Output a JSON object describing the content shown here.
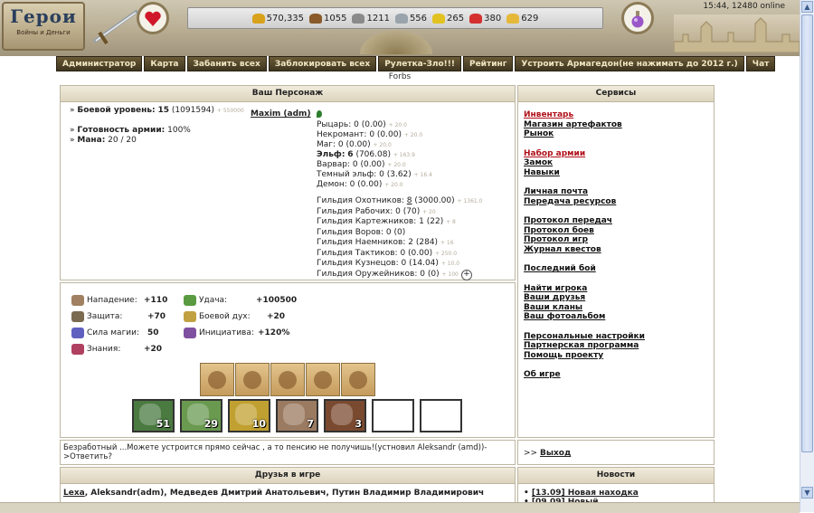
{
  "header": {
    "logo_title": "Герои",
    "logo_subtitle": "Войны и Деньги",
    "status_time": "15:44, 12480 online",
    "resources": [
      {
        "icon": "gold-icon",
        "value": "570,335"
      },
      {
        "icon": "wood-icon",
        "value": "1055"
      },
      {
        "icon": "ore-icon",
        "value": "1211"
      },
      {
        "icon": "mercury-icon",
        "value": "556"
      },
      {
        "icon": "sulfur-icon",
        "value": "265"
      },
      {
        "icon": "crystal-icon",
        "value": "380"
      },
      {
        "icon": "gems-icon",
        "value": "629"
      }
    ]
  },
  "menu": [
    "Администратор",
    "Карта",
    "Забанить всех",
    "Заблокировать всех",
    "Рулетка-Зло!!!",
    "Рейтинг",
    "Устроить Армагедон(не нажимать до 2012 г.)",
    "Чат"
  ],
  "forbs": "Forbs",
  "character": {
    "panel_title": "Ваш Персонаж",
    "name": "Maxim (adm)",
    "combat_level_label": "Боевой уровень:",
    "combat_level": "15",
    "combat_exp": "(1091594)",
    "combat_small": "+ 550000",
    "army_ready_label": "Готовность армии:",
    "army_ready": "100%",
    "mana_label": "Мана:",
    "mana": "20 / 20",
    "factions": [
      {
        "name": "Рыцарь:",
        "level": "0",
        "value": "(0.00)",
        "small": "+ 20.0",
        "bold": false
      },
      {
        "name": "Некромант:",
        "level": "0",
        "value": "(0.00)",
        "small": "+ 20.0",
        "bold": false
      },
      {
        "name": "Маг:",
        "level": "0",
        "value": "(0.00)",
        "small": "+ 20.0",
        "bold": false
      },
      {
        "name": "Эльф:",
        "level": "6",
        "value": "(706.08)",
        "small": "+ 163.9",
        "bold": true
      },
      {
        "name": "Варвар:",
        "level": "0",
        "value": "(0.00)",
        "small": "+ 20.0",
        "bold": false
      },
      {
        "name": "Темный эльф:",
        "level": "0",
        "value": "(3.62)",
        "small": "+ 16.4",
        "bold": false
      },
      {
        "name": "Демон:",
        "level": "0",
        "value": "(0.00)",
        "small": "+ 20.0",
        "bold": false
      }
    ],
    "guilds": [
      {
        "name": "Гильдия Охотников:",
        "level": "8",
        "value": "(3000.00)",
        "small": "+ 1361.0"
      },
      {
        "name": "Гильдия Рабочих:",
        "level": "0",
        "value": "(70)",
        "small": "+ 20"
      },
      {
        "name": "Гильдия Картежников:",
        "level": "1",
        "value": "(22)",
        "small": "+ 8"
      },
      {
        "name": "Гильдия Воров:",
        "level": "0",
        "value": "(0)",
        "small": ""
      },
      {
        "name": "Гильдия Наемников:",
        "level": "2",
        "value": "(284)",
        "small": "+ 16"
      },
      {
        "name": "Гильдия Тактиков:",
        "level": "0",
        "value": "(0.00)",
        "small": "+ 250.0"
      },
      {
        "name": "Гильдия Кузнецов:",
        "level": "0",
        "value": "(14.04)",
        "small": "+ 10.0"
      },
      {
        "name": "Гильдия Оружейников:",
        "level": "0",
        "value": "(0)",
        "small": "+ 100"
      }
    ],
    "plus_symbol": "+"
  },
  "stats": [
    {
      "icon": "attack-icon",
      "label": "Нападение:",
      "value": "+110"
    },
    {
      "icon": "defense-icon",
      "label": "Защита:",
      "value": "+70"
    },
    {
      "icon": "spellpower-icon",
      "label": "Сила магии:",
      "value": "50"
    },
    {
      "icon": "knowledge-icon",
      "label": "Знания:",
      "value": "+20"
    },
    {
      "icon": "luck-icon",
      "label": "Удача:",
      "value": "+100500"
    },
    {
      "icon": "morale-icon",
      "label": "Боевой дух:",
      "value": "+20"
    },
    {
      "icon": "initiative-icon",
      "label": "Инициатива:",
      "value": "+120%"
    }
  ],
  "army": [
    "51",
    "29",
    "10",
    "7",
    "3",
    "",
    ""
  ],
  "chat": {
    "message": "Безработный ...Можете устроится прямо сейчас , а то пенсию не получишь!(устновил Aleksandr (amd))->Ответить?",
    "exit_prefix": ">>",
    "exit_label": "Выход"
  },
  "services": {
    "title": "Сервисы",
    "groups": [
      [
        {
          "t": "Инвентарь",
          "red": true
        },
        {
          "t": "Магазин артефактов",
          "red": false
        },
        {
          "t": "Рынок",
          "red": false
        }
      ],
      [
        {
          "t": "Набор армии",
          "red": true
        },
        {
          "t": "Замок",
          "red": false
        },
        {
          "t": "Навыки",
          "red": false
        }
      ],
      [
        {
          "t": "Личная почта",
          "red": false
        },
        {
          "t": "Передача ресурсов",
          "red": false
        }
      ],
      [
        {
          "t": "Протокол передач",
          "red": false
        },
        {
          "t": "Протокол боев",
          "red": false
        },
        {
          "t": "Протокол игр",
          "red": false
        },
        {
          "t": "Журнал квестов",
          "red": false
        }
      ],
      [
        {
          "t": "Последний бой",
          "red": false
        }
      ],
      [
        {
          "t": "Найти игрока",
          "red": false
        },
        {
          "t": "Ваши друзья",
          "red": false
        },
        {
          "t": "Ваши кланы",
          "red": false
        },
        {
          "t": "Ваш фотоальбом",
          "red": false
        }
      ],
      [
        {
          "t": "Персональные настройки",
          "red": false
        },
        {
          "t": "Партнерская программа",
          "red": false
        },
        {
          "t": "Помощь проекту",
          "red": false
        }
      ],
      [
        {
          "t": "Об игре",
          "red": false
        }
      ]
    ]
  },
  "friends": {
    "title": "Друзья в игре",
    "list": [
      "Lexa",
      "Aleksandr(adm)",
      "Медведев Дмитрий Анатольевич",
      "Путин Владимир Владимирович"
    ]
  },
  "news": {
    "title": "Новости",
    "items": [
      "[13.09] Новая находка",
      "[09.09] Новый ..."
    ]
  }
}
